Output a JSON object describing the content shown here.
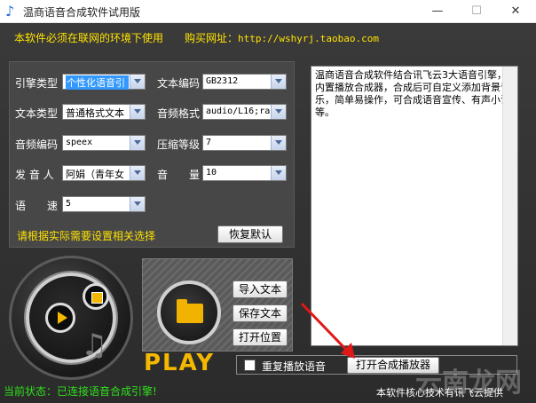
{
  "window": {
    "title": "温商语音合成软件试用版",
    "minimize": "—",
    "maximize": "☐",
    "close": "✕"
  },
  "notice": {
    "left": "本软件必须在联网的环境下使用",
    "right_prefix": "购买网址：",
    "url": "http://wshyrj.taobao.com"
  },
  "form": {
    "engine_type": {
      "label": "引擎类型",
      "value": "个性化语音引"
    },
    "text_encoding": {
      "label": "文本编码",
      "value": "GB2312"
    },
    "text_type": {
      "label": "文本类型",
      "value": "普通格式文本"
    },
    "audio_format": {
      "label": "音频格式",
      "value": "audio/L16;ra"
    },
    "audio_codec": {
      "label": "音频编码",
      "value": "speex"
    },
    "compress_level": {
      "label": "压缩等级",
      "value": "7"
    },
    "speaker": {
      "label": "发 音 人",
      "value": "阿娟（青年女"
    },
    "volume": {
      "label": "音　　量",
      "value": "10"
    },
    "speed": {
      "label": "语　　速",
      "value": "5"
    },
    "hint": "请根据实际需要设置相关选择",
    "reset_button": "恢复默认"
  },
  "editor": {
    "text": "温商语音合成软件结合讯飞云3大语音引擎，内置播放合成器，合成后可自定义添加背景音乐，简单易操作，可合成语音宣传、有声小说等。"
  },
  "actions": {
    "import_text": "导入文本",
    "save_text": "保存文本",
    "open_location": "打开位置",
    "play_label": "PLAY",
    "repeat_label": "重复播放语音",
    "open_player": "打开合成播放器"
  },
  "status": {
    "left": "当前状态：已连接语音合成引擎!",
    "right": "本软件核心技术有讯飞云提供"
  },
  "watermark": "云南龙网",
  "colors": {
    "notice": "#ffe300",
    "status_ok": "#2fe01c",
    "accent": "#f5b800",
    "annotation_arrow": "#e01818"
  }
}
